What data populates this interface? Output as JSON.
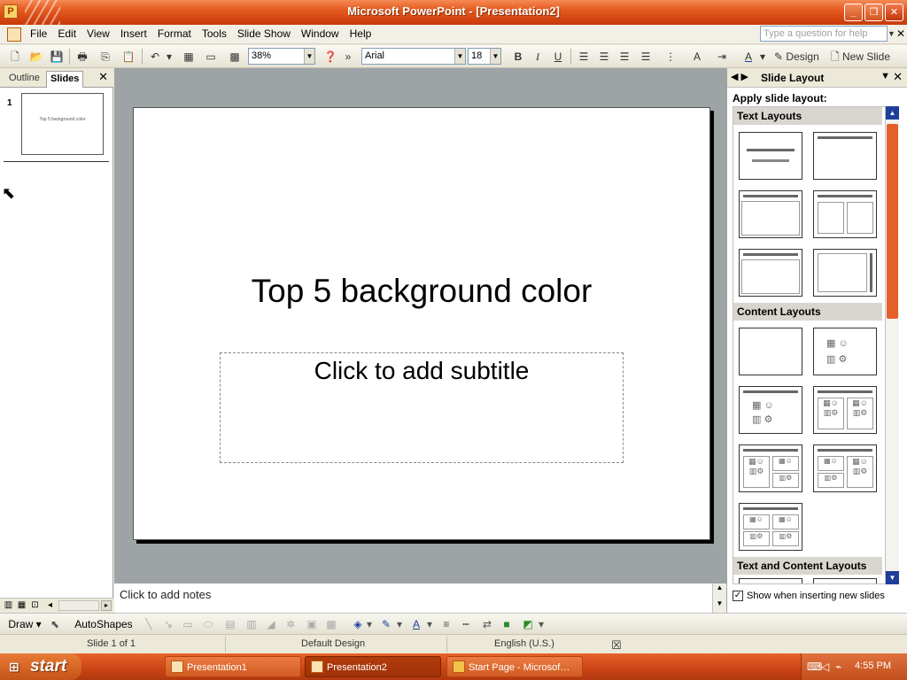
{
  "window": {
    "title": "Microsoft PowerPoint - [Presentation2]",
    "buttons": {
      "minimize": "_",
      "restore": "❐",
      "close": "✕"
    }
  },
  "menu": {
    "items": [
      "File",
      "Edit",
      "View",
      "Insert",
      "Format",
      "Tools",
      "Slide Show",
      "Window",
      "Help"
    ],
    "help_placeholder": "Type a question for help",
    "close_doc": "✕"
  },
  "toolbar": {
    "zoom": "38%",
    "font": "Arial",
    "size": "18",
    "design_label": "Design",
    "new_slide_label": "New Slide"
  },
  "left_pane": {
    "tab_outline": "Outline",
    "tab_slides": "Slides",
    "close": "✕",
    "slide_number": "1",
    "thumb_title": "Top 5 background color"
  },
  "slide": {
    "title": "Top 5 background color",
    "subtitle_placeholder": "Click to add subtitle"
  },
  "notes": {
    "placeholder": "Click to add notes"
  },
  "task_pane": {
    "title": "Slide Layout",
    "apply_label": "Apply slide layout:",
    "sections": [
      "Text Layouts",
      "Content Layouts",
      "Text and Content Layouts"
    ],
    "show_when_inserting": "Show when inserting new slides",
    "show_checked": true,
    "close": "✕"
  },
  "drawing_toolbar": {
    "draw_label": "Draw",
    "autoshapes_label": "AutoShapes"
  },
  "status_bar": {
    "slide_of": "Slide 1 of 1",
    "design": "Default Design",
    "language": "English (U.S.)"
  },
  "taskbar": {
    "start_label": "start",
    "tasks": [
      "Presentation1",
      "Presentation2",
      "Start Page - Microsof…"
    ],
    "clock": "4:55 PM"
  },
  "colors": {
    "titlebar": "#e45a1f",
    "slide_area_bg": "#9ea3a6",
    "taskbar": "#c94316"
  }
}
